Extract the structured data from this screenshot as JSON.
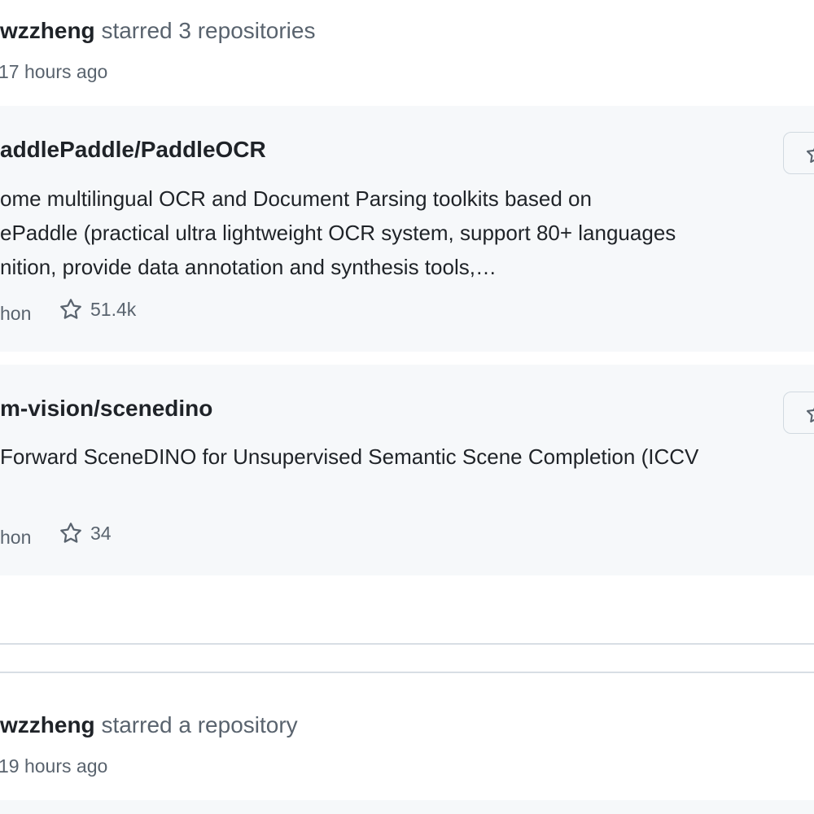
{
  "events": [
    {
      "actor": "wzzheng",
      "action": "starred 3 repositories",
      "time": "17 hours ago",
      "repos": [
        {
          "name": "addlePaddle/PaddleOCR",
          "description": "ome multilingual OCR and Document Parsing toolkits based on\nePaddle (practical ultra lightweight OCR system, support 80+ languages\nnition, provide data annotation and synthesis tools,…",
          "language": "hon",
          "stars": "51.4k"
        },
        {
          "name": "m-vision/scenedino",
          "description": "Forward SceneDINO for Unsupervised Semantic Scene Completion (ICCV",
          "language": "hon",
          "stars": "34"
        }
      ]
    },
    {
      "actor": "wzzheng",
      "action": "starred a repository",
      "time": "19 hours ago"
    }
  ],
  "icons": {
    "star": "star-icon"
  },
  "colors": {
    "card_background": "#f6f8fa",
    "primary_text": "#1f2328",
    "muted_text": "#59636e",
    "border": "#d1d9e0"
  }
}
